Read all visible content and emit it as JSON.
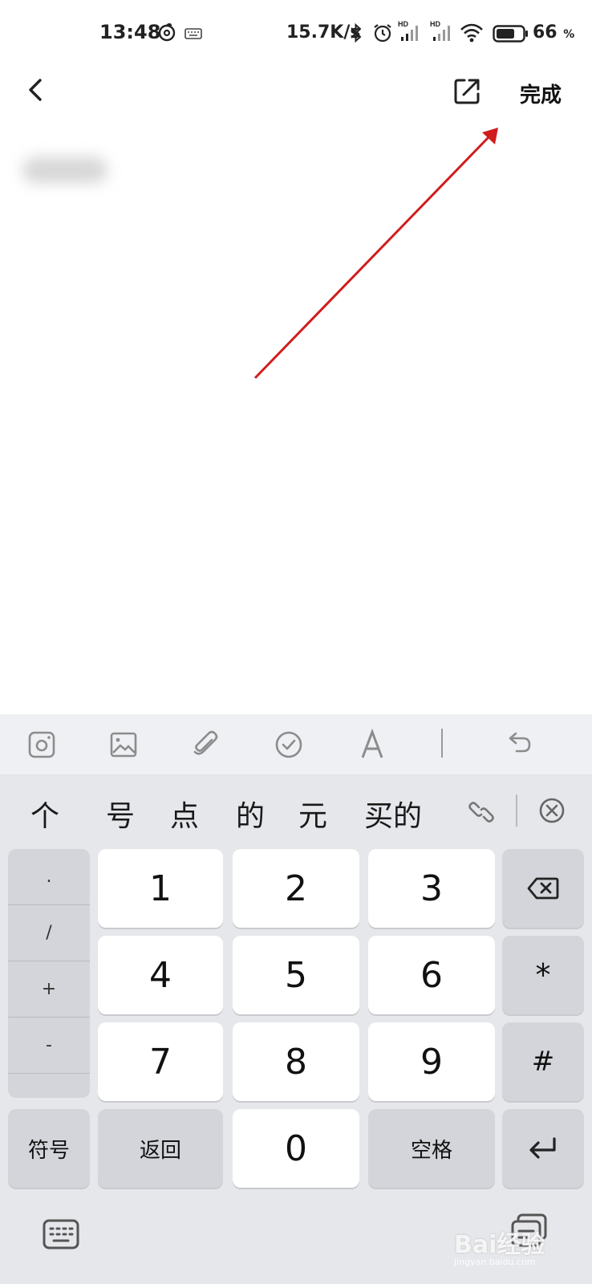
{
  "status_bar": {
    "time": "13:48",
    "net_speed": "15.7K/s",
    "battery_value": "66",
    "battery_unit": "%",
    "icons": [
      "netease-music-icon",
      "keyboard-icon",
      "bluetooth-icon",
      "alarm-icon",
      "hd-signal-icon",
      "hd-signal-icon",
      "wifi-icon",
      "battery-icon"
    ]
  },
  "nav": {
    "back_icon": "chevron-left-icon",
    "share_icon": "share-out-icon",
    "done_label": "完成"
  },
  "annotation": {
    "arrow_color": "#d01c1c"
  },
  "toolbar": {
    "items": [
      "camera-icon",
      "image-icon",
      "attachment-icon",
      "checklist-icon",
      "text-format-icon",
      "undo-icon"
    ]
  },
  "keyboard": {
    "candidates": [
      "个",
      "号",
      "点",
      "的",
      "元",
      "买的"
    ],
    "symbols": [
      ".",
      "/",
      "+",
      "-"
    ],
    "digits": [
      "1",
      "2",
      "3",
      "4",
      "5",
      "6",
      "7",
      "8",
      "9",
      "0"
    ],
    "star": "*",
    "hash": "#",
    "symbols_label": "符号",
    "back_label": "返回",
    "space_label": "空格"
  },
  "watermark": {
    "text": "Bai经验",
    "sub": "jingyan.baidu.com"
  }
}
